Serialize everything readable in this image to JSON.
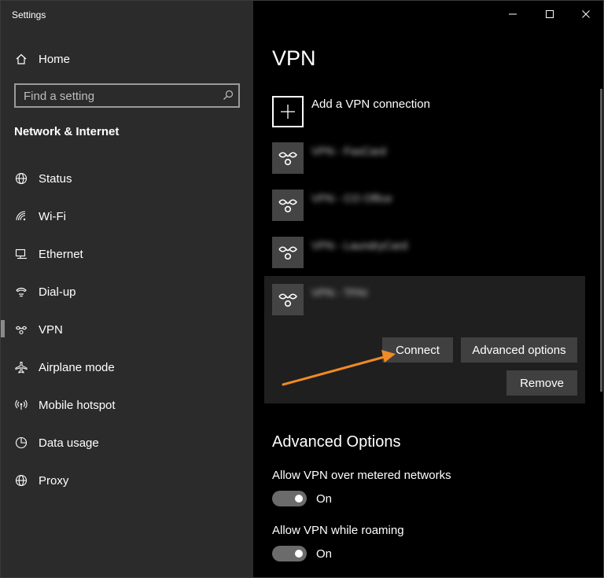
{
  "window": {
    "title": "Settings"
  },
  "sidebar": {
    "home_label": "Home",
    "search_placeholder": "Find a setting",
    "section_title": "Network & Internet",
    "items": [
      {
        "label": "Status",
        "icon": "globe-icon"
      },
      {
        "label": "Wi-Fi",
        "icon": "wifi-icon"
      },
      {
        "label": "Ethernet",
        "icon": "ethernet-icon"
      },
      {
        "label": "Dial-up",
        "icon": "dialup-icon"
      },
      {
        "label": "VPN",
        "icon": "vpn-icon",
        "selected": true
      },
      {
        "label": "Airplane mode",
        "icon": "airplane-icon"
      },
      {
        "label": "Mobile hotspot",
        "icon": "hotspot-icon"
      },
      {
        "label": "Data usage",
        "icon": "data-usage-icon"
      },
      {
        "label": "Proxy",
        "icon": "globe-icon"
      }
    ]
  },
  "main": {
    "title": "VPN",
    "add_vpn_label": "Add a VPN connection",
    "connections": [
      {
        "name": "VPN - FasCard"
      },
      {
        "name": "VPN - CO Office"
      },
      {
        "name": "VPN - LaundryCard"
      },
      {
        "name": "VPN - TPAI",
        "expanded": true
      }
    ],
    "buttons": {
      "connect": "Connect",
      "advanced_options": "Advanced options",
      "remove": "Remove"
    },
    "advanced": {
      "title": "Advanced Options",
      "options": [
        {
          "label": "Allow VPN over metered networks",
          "state": "On"
        },
        {
          "label": "Allow VPN while roaming",
          "state": "On"
        }
      ]
    }
  },
  "colors": {
    "sidebar_bg": "#2b2b2b",
    "content_bg": "#000000",
    "button_bg": "#404040",
    "annotation_arrow": "#f08a24"
  }
}
